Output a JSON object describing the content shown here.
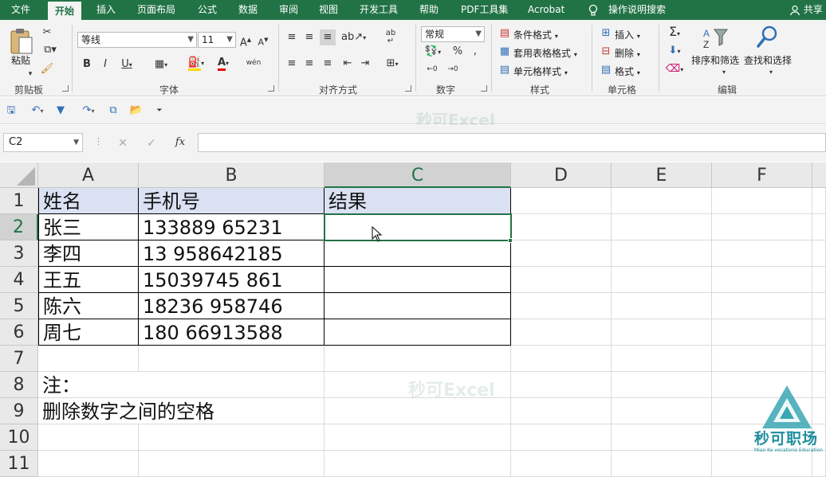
{
  "menu": {
    "tabs": [
      "文件",
      "开始",
      "插入",
      "页面布局",
      "公式",
      "数据",
      "审阅",
      "视图",
      "开发工具",
      "帮助",
      "PDF工具集",
      "Acrobat"
    ],
    "active_tab": "开始",
    "tell_me": "操作说明搜索",
    "share": "共享"
  },
  "ribbon": {
    "clipboard": {
      "paste": "粘贴",
      "label": "剪贴板"
    },
    "font": {
      "name": "等线",
      "size": "11",
      "label": "字体",
      "wen": "wén"
    },
    "alignment": {
      "label": "对齐方式"
    },
    "number": {
      "format": "常规",
      "label": "数字"
    },
    "styles": {
      "conditional": "条件格式",
      "table": "套用表格格式",
      "cell_styles": "单元格样式",
      "label": "样式"
    },
    "cells": {
      "insert": "插入",
      "delete": "删除",
      "format": "格式",
      "label": "单元格"
    },
    "editing": {
      "sort_filter": "排序和筛选",
      "find_select": "查找和选择",
      "label": "编辑"
    }
  },
  "formula_bar": {
    "name_box": "C2",
    "fx": "fx",
    "value": ""
  },
  "watermark": "秒可Excel",
  "logo": {
    "text": "秒可职场",
    "sub": "Miao Ke vocations Education"
  },
  "sheet": {
    "columns": [
      "A",
      "B",
      "C",
      "D",
      "E",
      "F"
    ],
    "rows": [
      "1",
      "2",
      "3",
      "4",
      "5",
      "6",
      "7",
      "8",
      "9",
      "10",
      "11"
    ],
    "selected_cell": "C2",
    "cells": {
      "A1": "姓名",
      "B1": "手机号",
      "C1": "结果",
      "A2": "张三",
      "B2": "133889 65231",
      "A3": "李四",
      "B3": "13 958642185",
      "A4": "王五",
      "B4": "15039745 861",
      "A5": "陈六",
      "B5": "18236 958746",
      "A6": "周七",
      "B6": "180 66913588",
      "A8": "注：",
      "A9": "删除数字之间的空格"
    }
  },
  "colors": {
    "accent": "#217346",
    "header_fill": "#d9e1f2"
  }
}
